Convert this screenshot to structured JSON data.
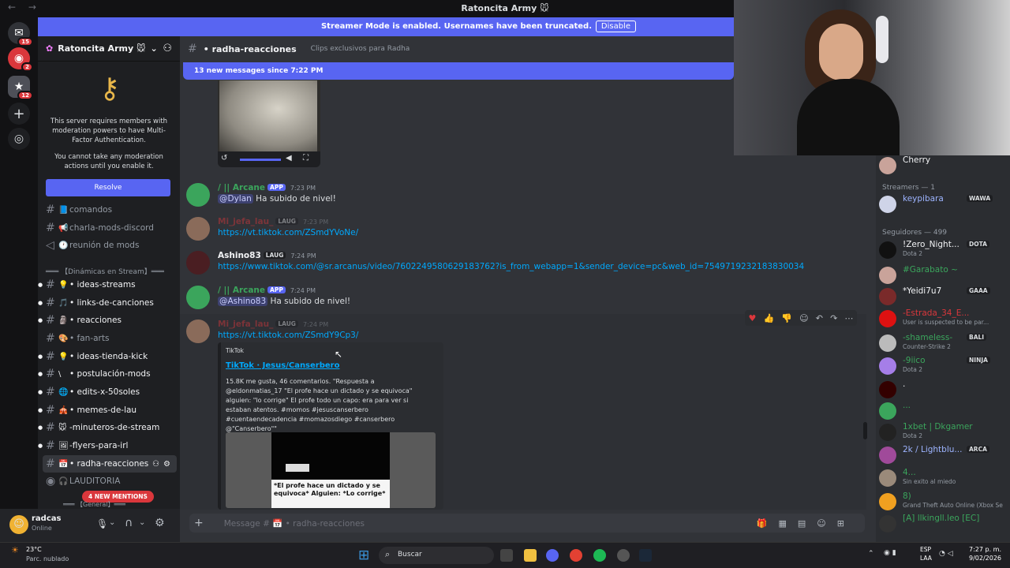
{
  "window": {
    "title": "Ratoncita Army 🐭"
  },
  "banner": {
    "message": "Streamer Mode is enabled. Usernames have been truncated.",
    "disable": "Disable"
  },
  "guilds": {
    "badge1": "15",
    "badge2": "2",
    "badge3": "12"
  },
  "server": {
    "name": "Ratoncita Army 🐭"
  },
  "mfa": {
    "text1": "This server requires members with moderation powers to have Multi-Factor Authentication.",
    "text2": "You cannot take any moderation actions until you enable it.",
    "resolve": "Resolve"
  },
  "channels": [
    {
      "emoji": "📘",
      "name": "comandos"
    },
    {
      "emoji": "📢",
      "name": "charla-mods-discord"
    },
    {
      "emoji": "🕐",
      "name": "reunión de mods"
    }
  ],
  "category1": "═══ 【Dinámicas en Stream】═══",
  "channels2": [
    {
      "emoji": "💡",
      "name": "• ideas-streams"
    },
    {
      "emoji": "🎵",
      "name": "• links-de-canciones"
    },
    {
      "emoji": "🗿",
      "name": "• reacciones"
    },
    {
      "emoji": "🎨",
      "name": "• fan-arts"
    },
    {
      "emoji": "💡",
      "name": "• ideas-tienda-kick"
    },
    {
      "emoji": "\\",
      "name": "• postulación-mods"
    },
    {
      "emoji": "🌐",
      "name": "• edits-x-50soles"
    },
    {
      "emoji": "🎪",
      "name": "• memes-de-lau"
    },
    {
      "emoji": "🐭",
      "name": "-minuteros-de-stream"
    },
    {
      "emoji": "🖼",
      "name": "-flyers-para-irl"
    },
    {
      "emoji": "📅",
      "name": "• radha-reacciones"
    },
    {
      "emoji": "🎧",
      "name": "LAUDITORIA"
    }
  ],
  "mentions_pill": "4 NEW MENTIONS",
  "category2": "═══ 【General】═══",
  "user": {
    "name": "radcas",
    "status": "Online"
  },
  "channel_header": {
    "name": "• radha-reacciones",
    "topic": "Clips exclusivos para Radha"
  },
  "new_messages": "13 new messages since 7:22 PM",
  "messages": [
    {
      "name": "/ || Arcane",
      "tag": "APP",
      "time": "7:23 PM",
      "mention": "@Dylan",
      "text": " Ha subido de nivel!"
    },
    {
      "name": "Mi_jefa_lau_",
      "tag": "LAUG",
      "time": "7:23 PM",
      "link": "https://vt.tiktok.com/ZSmdYVoNe/"
    },
    {
      "name": "Ashino83",
      "tag": "LAUG",
      "time": "7:24 PM",
      "link": "https://www.tiktok.com/@sr.arcanus/video/7602249580629183762?is_from_webapp=1&sender_device=pc&web_id=7549719232183830034"
    },
    {
      "name": "/ || Arcane",
      "tag": "APP",
      "time": "7:24 PM",
      "mention": "@Ashino83",
      "text": " Ha subido de nivel!"
    },
    {
      "name": "Mi_jefa_lau_",
      "tag": "LAUG",
      "time": "7:24 PM",
      "link": "https://vt.tiktok.com/ZSmdY9Cp3/"
    }
  ],
  "embed": {
    "provider": "TikTok",
    "title": "TikTok · Jesus/Canserbero",
    "desc": "15.8K me gusta, 46 comentarios. \"Respuesta a @eldonmatias_17 \"El profe hace un dictado y se equivoca\" alguien: \"lo corrige\" El profe todo un capo: era para ver si estaban atentos. #momos #jesuscanserbero #cuentaendecadencia #momazosdiego #canserbero @\"Canserbero\"\"",
    "thumb_text": "*El profe hace un dictado y se equivoca* Alguien: *Lo corrige*"
  },
  "composer": {
    "placeholder": "Message # 📅 • radha-reacciones"
  },
  "members": {
    "top": "Cherry",
    "cat1": "Streamers — 1",
    "cat2": "Seguidores — 499",
    "list": [
      {
        "name": "keypibara",
        "badge": "WAWA",
        "sub": ""
      },
      {
        "name": "!Zero_Night...",
        "badge": "DOTA",
        "sub": "Dota 2"
      },
      {
        "name": "#Garabato ~",
        "badge": "",
        "sub": ""
      },
      {
        "name": "*Yeidi7u7",
        "badge": "GAAA",
        "sub": ""
      },
      {
        "name": "-Estrada_34_E...",
        "badge": "",
        "sub": "User is suspected to be par..."
      },
      {
        "name": "-shameless-",
        "badge": "BALI",
        "sub": "Counter-Strike 2"
      },
      {
        "name": "-9iico",
        "badge": "NINJA",
        "sub": "Dota 2"
      },
      {
        "name": ".",
        "badge": "",
        "sub": ""
      },
      {
        "name": "...",
        "badge": "",
        "sub": ""
      },
      {
        "name": "1xbet | Dkgamer",
        "badge": "",
        "sub": "Dota 2"
      },
      {
        "name": "2k / Lightblu...",
        "badge": "ARCA",
        "sub": ""
      },
      {
        "name": "4...",
        "badge": "",
        "sub": "Sin exito al miedo"
      },
      {
        "name": "8)",
        "badge": "",
        "sub": "Grand Theft Auto Online (Xbox Se"
      },
      {
        "name": "[A] llkingll.leo [EC]",
        "badge": "",
        "sub": ""
      }
    ]
  },
  "taskbar": {
    "temp": "23°C",
    "weather": "Parc. nublado",
    "search": "Buscar",
    "lang1": "ESP",
    "lang2": "LAA",
    "time": "7:27 p. m.",
    "date": "9/02/2026"
  }
}
